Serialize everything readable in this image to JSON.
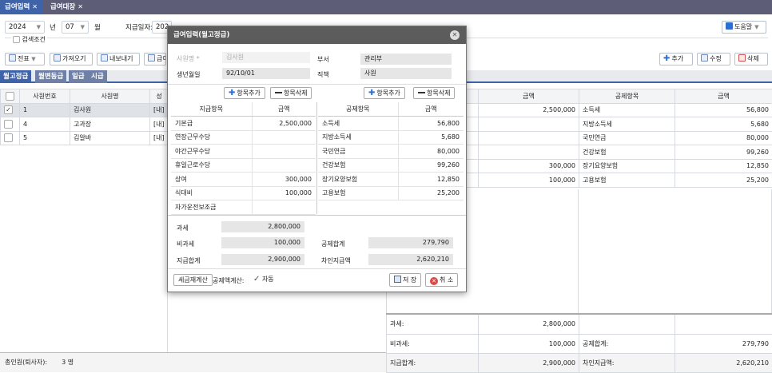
{
  "tabs": [
    {
      "label": "급여입력"
    },
    {
      "label": "급여대장"
    }
  ],
  "filter": {
    "year": "2024",
    "year_unit": "년",
    "month": "07",
    "month_unit": "월",
    "pay_date_label": "지급일자:",
    "pay_date_partial": "202",
    "help": "도움말",
    "search_cond": "검색조건"
  },
  "toolbar": {
    "slip": "전표",
    "import": "가져오기",
    "export": "내보내기",
    "partial": "급여",
    "add": "추가",
    "edit": "수정",
    "delete": "삭제"
  },
  "subtabs": [
    "월고정급",
    "월변동급",
    "일급",
    "시급"
  ],
  "emp_table": {
    "headers": [
      "사원번호",
      "사원명",
      "성"
    ],
    "rows": [
      {
        "no": "1",
        "name": "김사원",
        "c": "[내]",
        "checked": true
      },
      {
        "no": "4",
        "name": "고과장",
        "c": "[내]",
        "checked": false
      },
      {
        "no": "5",
        "name": "김알바",
        "c": "[내]",
        "checked": false
      }
    ]
  },
  "right_table": {
    "headers": [
      "금액",
      "공제항목",
      "금액"
    ],
    "rows": [
      {
        "amt": "2,500,000",
        "ded": "소득세",
        "damt": "56,800"
      },
      {
        "amt": "",
        "ded": "지방소득세",
        "damt": "5,680"
      },
      {
        "amt": "",
        "ded": "국민연금",
        "damt": "80,000"
      },
      {
        "amt": "",
        "ded": "건강보험",
        "damt": "99,260"
      },
      {
        "amt": "300,000",
        "ded": "장기요양보험",
        "damt": "12,850"
      },
      {
        "amt": "100,000",
        "ded": "고용보험",
        "damt": "25,200"
      }
    ],
    "summary": [
      {
        "l": "과세:",
        "v": "2,800,000",
        "l2": "",
        "v2": ""
      },
      {
        "l": "비과세:",
        "v": "100,000",
        "l2": "공제합계:",
        "v2": "279,790"
      },
      {
        "l": "지급합계:",
        "v": "2,900,000",
        "l2": "차인지급액:",
        "v2": "2,620,210"
      }
    ]
  },
  "footer": {
    "label": "총인원(퇴사자):",
    "value": "3 명"
  },
  "modal": {
    "title": "급여입력(월고정급)",
    "emp_label": "사원명",
    "emp_value": "김사원",
    "dept_label": "부서",
    "dept_value": "관리부",
    "birth_label": "생년월일",
    "birth_value": "92/10/01",
    "pos_label": "직책",
    "pos_value": "사원",
    "add_item": "항목추가",
    "del_item": "항목삭제",
    "pay_headers": [
      "지급항목",
      "금액"
    ],
    "pay_rows": [
      {
        "n": "기본급",
        "v": "2,500,000"
      },
      {
        "n": "연장근무수당",
        "v": ""
      },
      {
        "n": "야간근무수당",
        "v": ""
      },
      {
        "n": "휴일근로수당",
        "v": ""
      },
      {
        "n": "상여",
        "v": "300,000"
      },
      {
        "n": "식대비",
        "v": "100,000"
      },
      {
        "n": "자가운전보조금",
        "v": ""
      }
    ],
    "ded_headers": [
      "공제항목",
      "금액"
    ],
    "ded_rows": [
      {
        "n": "소득세",
        "v": "56,800"
      },
      {
        "n": "지방소득세",
        "v": "5,680"
      },
      {
        "n": "국민연금",
        "v": "80,000"
      },
      {
        "n": "건강보험",
        "v": "99,260"
      },
      {
        "n": "장기요양보험",
        "v": "12,850"
      },
      {
        "n": "고용보험",
        "v": "25,200"
      }
    ],
    "tax_label": "과세",
    "tax_value": "2,800,000",
    "nontax_label": "비과세",
    "nontax_value": "100,000",
    "total_label": "지급합계",
    "total_value": "2,900,000",
    "dedsum_label": "공제합계",
    "dedsum_value": "279,790",
    "net_label": "차인지급액",
    "net_value": "2,620,210",
    "recalc": "세금재계산",
    "dedcalc_label": "공제액계산:",
    "auto": "자동",
    "save": "저 장",
    "cancel": "취 소"
  }
}
